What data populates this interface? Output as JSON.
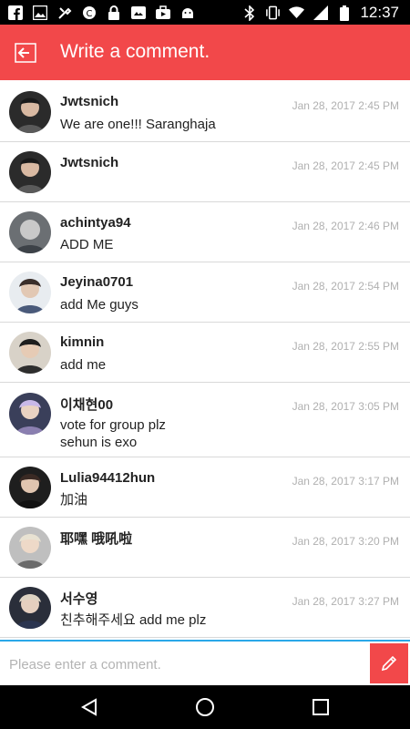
{
  "status_bar": {
    "time": "12:37",
    "left_icons": [
      "facebook-icon",
      "image-icon",
      "tools-icon",
      "copyright-icon",
      "lock-icon",
      "news-icon",
      "briefcase-icon",
      "android-icon"
    ],
    "right_icons": [
      "bluetooth-icon",
      "vibrate-icon",
      "wifi-icon",
      "signal-icon",
      "battery-icon"
    ]
  },
  "header": {
    "title": "Write a comment.",
    "back_icon": "back-arrow-icon",
    "background": "#f2484a"
  },
  "comments": [
    {
      "username": "Jwtsnich",
      "date": "Jan 28, 2017 2:45 PM",
      "message": "We are one!!! Saranghaja",
      "message2": ""
    },
    {
      "username": "Jwtsnich",
      "date": "Jan 28, 2017 2:45 PM",
      "message": "",
      "message2": ""
    },
    {
      "username": "achintya94",
      "date": "Jan 28, 2017 2:46 PM",
      "message": "ADD ME",
      "message2": ""
    },
    {
      "username": "Jeyina0701",
      "date": "Jan 28, 2017 2:54 PM",
      "message": "add Me guys",
      "message2": ""
    },
    {
      "username": "kimnin",
      "date": "Jan 28, 2017 2:55 PM",
      "message": "add me",
      "message2": ""
    },
    {
      "username": "이채현00",
      "date": "Jan 28, 2017 3:05 PM",
      "message": "vote for group plz",
      "message2": "sehun is exo"
    },
    {
      "username": "Lulia94412hun",
      "date": "Jan 28, 2017 3:17 PM",
      "message": "加油",
      "message2": ""
    },
    {
      "username": "耶嘿 哦吼啦",
      "date": "Jan 28, 2017 3:20 PM",
      "message": "",
      "message2": ""
    },
    {
      "username": "서수영",
      "date": "Jan 28, 2017 3:27 PM",
      "message": "친추해주세요 add me plz",
      "message2": ""
    }
  ],
  "input": {
    "placeholder": "Please enter a comment.",
    "value": "",
    "send_icon": "pencil-icon",
    "accent": "#2aa8e8"
  },
  "nav_bar": {
    "back_icon": "nav-back-icon",
    "home_icon": "nav-home-icon",
    "recents_icon": "nav-recents-icon"
  }
}
